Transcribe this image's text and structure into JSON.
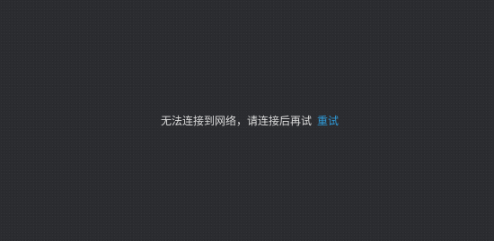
{
  "error": {
    "message": "无法连接到网络，请连接后再试",
    "retry_label": "重试"
  },
  "colors": {
    "background": "#2b2c30",
    "text": "#dcdcdc",
    "link": "#2f9ad8"
  }
}
